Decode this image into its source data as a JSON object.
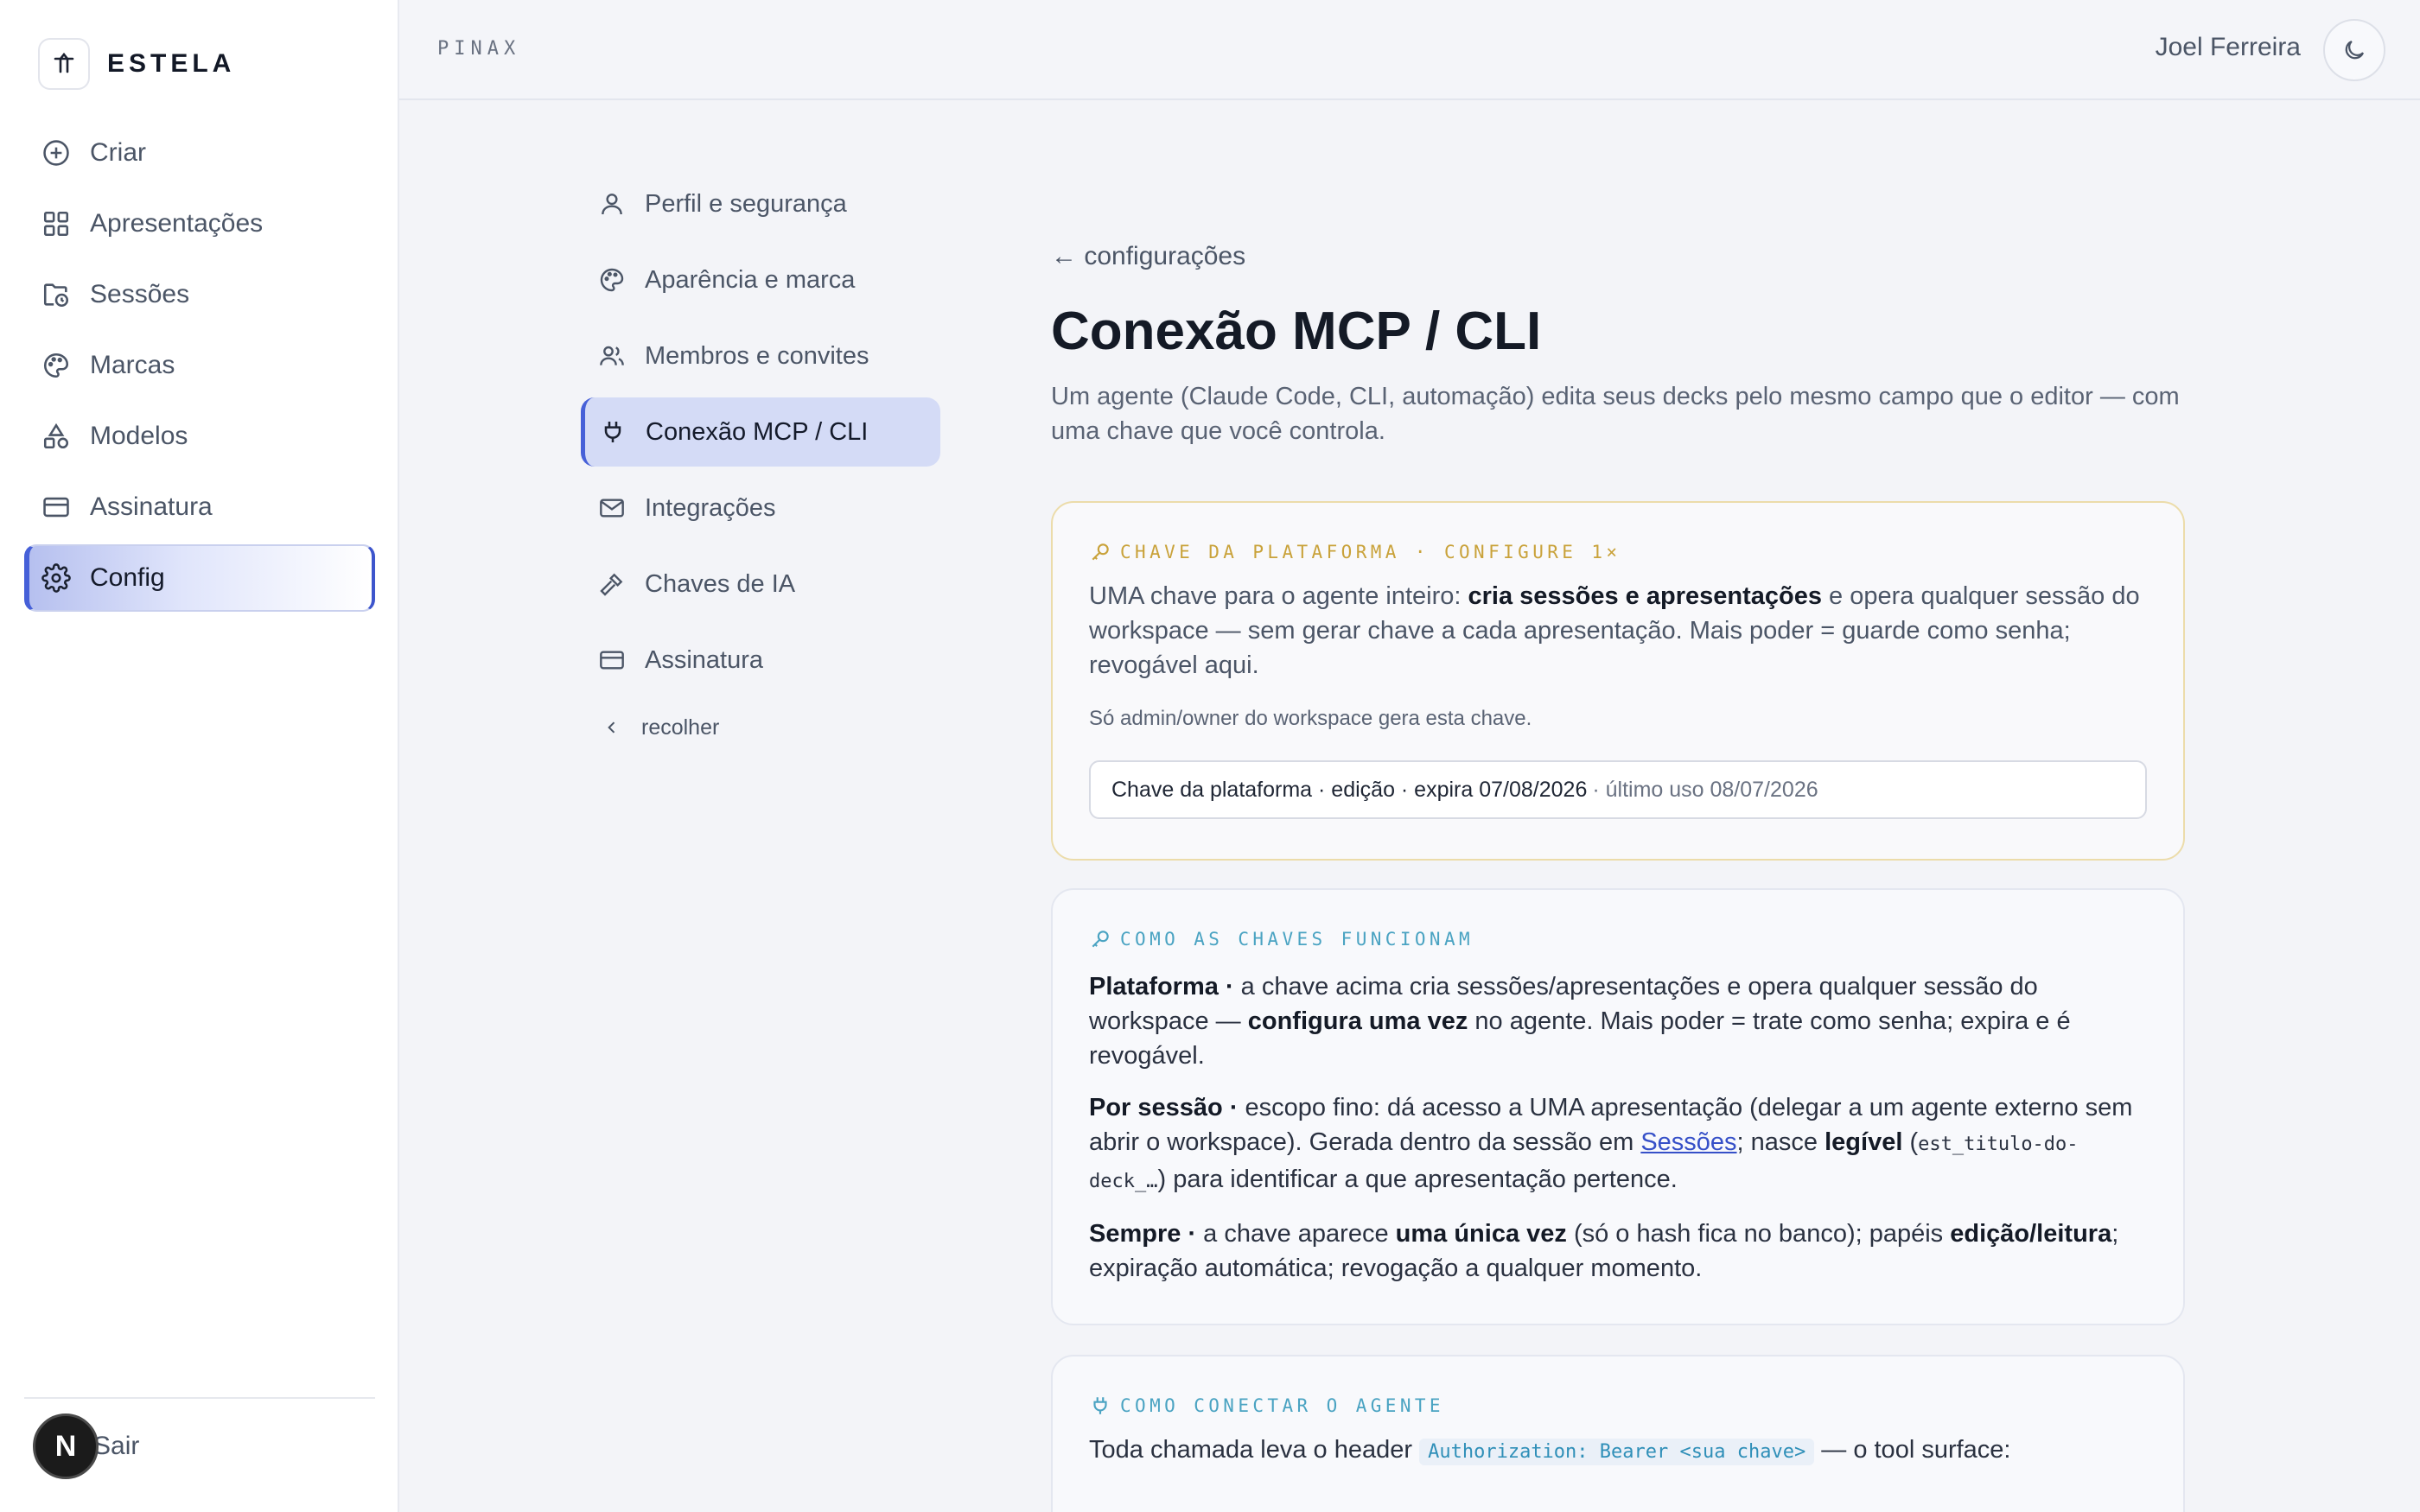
{
  "brand": {
    "name": "ESTELA"
  },
  "sidebar": {
    "items": [
      {
        "label": "Criar",
        "icon": "plus-circle-icon"
      },
      {
        "label": "Apresentações",
        "icon": "grid-icon"
      },
      {
        "label": "Sessões",
        "icon": "folder-clock-icon"
      },
      {
        "label": "Marcas",
        "icon": "palette-icon"
      },
      {
        "label": "Modelos",
        "icon": "shapes-icon"
      },
      {
        "label": "Assinatura",
        "icon": "credit-card-icon"
      },
      {
        "label": "Config",
        "icon": "gear-icon",
        "active": true
      }
    ],
    "logout_label": "Sair",
    "fab_letter": "N"
  },
  "topbar": {
    "workspace": "PINAX",
    "user_name": "Joel Ferreira",
    "theme_icon": "moon-icon"
  },
  "settings_nav": {
    "items": [
      {
        "label": "Perfil e segurança",
        "icon": "user-icon"
      },
      {
        "label": "Aparência e marca",
        "icon": "palette-icon"
      },
      {
        "label": "Membros e convites",
        "icon": "users-icon"
      },
      {
        "label": "Conexão MCP / CLI",
        "icon": "plug-icon",
        "active": true
      },
      {
        "label": "Integrações",
        "icon": "mail-icon"
      },
      {
        "label": "Chaves de IA",
        "icon": "hammer-icon"
      },
      {
        "label": "Assinatura",
        "icon": "credit-card-icon"
      }
    ],
    "collapse_label": "recolher"
  },
  "main": {
    "back_label": "← configurações",
    "title": "Conexão MCP / CLI",
    "description": "Um agente (Claude Code, CLI, automação) edita seus decks pelo mesmo campo que o editor — com uma chave que você controla."
  },
  "platform_key": {
    "label": "CHAVE DA PLATAFORMA · CONFIGURE 1×",
    "lead_a": "UMA chave para o agente inteiro: ",
    "lead_b": "cria sessões e apresentações",
    "lead_c": " e opera qualquer sessão do workspace — sem gerar chave a cada apresentação. Mais poder = guarde como senha; revogável aqui.",
    "note": "Só admin/owner do workspace gera esta chave.",
    "key_summary": "Chave da plataforma · edição · expira 07/08/2026",
    "key_last_use": "· último uso 08/07/2026"
  },
  "how_keys": {
    "label": "COMO AS CHAVES FUNCIONAM",
    "p1_title": "Plataforma ·",
    "p1_a": " a chave acima cria sessões/apresentações e opera qualquer sessão do workspace — ",
    "p1_b": "configura uma vez",
    "p1_c": " no agente. Mais poder = trate como senha; expira e é revogável.",
    "p2_title": "Por sessão ·",
    "p2_a": " escopo fino: dá acesso a UMA apresentação (delegar a um agente externo sem abrir o workspace). Gerada dentro da sessão em ",
    "p2_link": "Sessões",
    "p2_b": "; nasce ",
    "p2_c": "legível",
    "p2_d": " (",
    "p2_code": "est_titulo-do-deck_…",
    "p2_e": ") para identificar a que apresentação pertence.",
    "p3_title": "Sempre ·",
    "p3_a": " a chave aparece ",
    "p3_b": "uma única vez",
    "p3_c": " (só o hash fica no banco); papéis ",
    "p3_d": "edição/leitura",
    "p3_e": "; expiração automática; revogação a qualquer momento."
  },
  "connect": {
    "label": "COMO CONECTAR O AGENTE",
    "text_a": "Toda chamada leva o header ",
    "code": "Authorization: Bearer <sua chave>",
    "text_b": " — o tool surface:"
  },
  "colors": {
    "accent": "#4660d8",
    "gold": "#c9a23a",
    "teal": "#4aa3c2"
  }
}
